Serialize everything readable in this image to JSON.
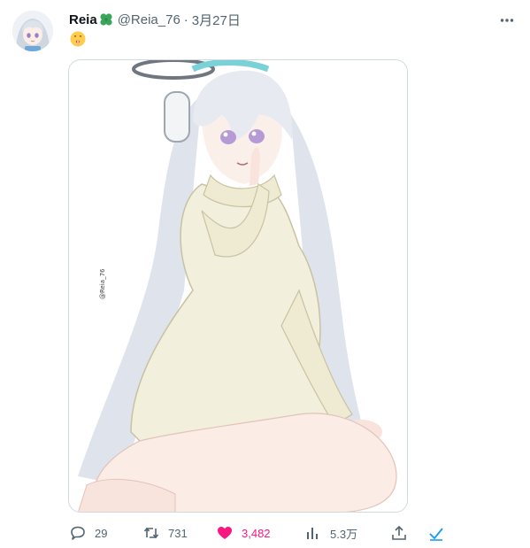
{
  "tweet": {
    "author_name": "Reia",
    "author_badge_icon": "four-leaf-clover-icon",
    "author_handle": "@Reia_76",
    "separator": "·",
    "date": "3月27日",
    "text_emoji": "🤫",
    "media_signature": "@Reia_76",
    "counts": {
      "replies": "29",
      "reposts": "731",
      "likes": "3,482",
      "views": "5.3万"
    },
    "liked": true
  },
  "colors": {
    "text_primary": "#0f1419",
    "text_secondary": "#536471",
    "like_pink": "#f91880",
    "accent_blue": "#1d9bf0",
    "border": "#cfd9de",
    "clover_green": "#3ba55c"
  },
  "icons": {
    "more": "more-horizontal-icon",
    "reply": "reply-bubble-icon",
    "repost": "repost-arrows-icon",
    "like": "heart-filled-icon",
    "views": "bar-chart-icon",
    "share": "share-upload-icon",
    "bookmark": "checkmark-icon"
  }
}
